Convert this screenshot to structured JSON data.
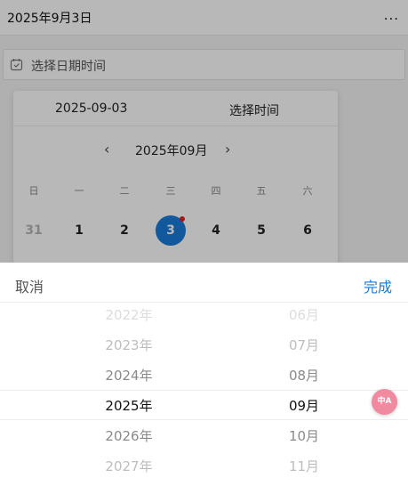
{
  "header": {
    "title": "2025年9月3日",
    "more_label": "..."
  },
  "picker_field": {
    "placeholder": "选择日期时间",
    "icon": "calendar-icon"
  },
  "panel": {
    "tabs": {
      "date": "2025-09-03",
      "time": "选择时间"
    },
    "month_label": "2025年09月",
    "prev_label": "‹",
    "next_label": "›",
    "weekdays": [
      "日",
      "一",
      "二",
      "三",
      "四",
      "五",
      "六"
    ],
    "days": [
      {
        "label": "31",
        "state": "muted"
      },
      {
        "label": "1",
        "state": "normal"
      },
      {
        "label": "2",
        "state": "normal"
      },
      {
        "label": "3",
        "state": "selected"
      },
      {
        "label": "4",
        "state": "normal"
      },
      {
        "label": "5",
        "state": "normal"
      },
      {
        "label": "6",
        "state": "normal"
      }
    ]
  },
  "sheet": {
    "cancel_label": "取消",
    "done_label": "完成",
    "years": [
      "2022年",
      "2023年",
      "2024年",
      "2025年",
      "2026年",
      "2027年"
    ],
    "months": [
      "06月",
      "07月",
      "08月",
      "09月",
      "10月",
      "11月"
    ],
    "selected_index": 3
  },
  "badge": {
    "label": "中A"
  },
  "colors": {
    "accent": "#1a7ad8",
    "today_dot": "#e0241a",
    "badge": "#f08aa0"
  }
}
